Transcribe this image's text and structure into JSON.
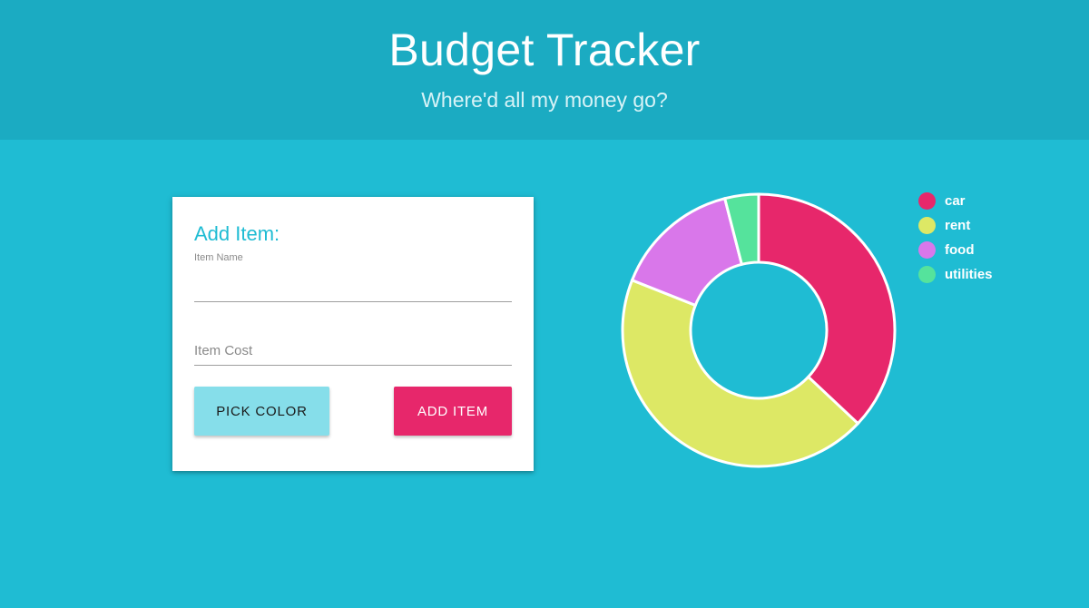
{
  "header": {
    "title": "Budget Tracker",
    "subtitle": "Where'd all my money go?"
  },
  "form": {
    "title": "Add Item:",
    "item_name_label": "Item Name",
    "item_name_value": "",
    "item_cost_placeholder": "Item Cost",
    "item_cost_value": "",
    "pick_color_label": "PICK COLOR",
    "add_item_label": "ADD ITEM"
  },
  "colors": {
    "page_bg": "#1fbcd3",
    "header_bg": "#1babc2",
    "accent": "#1fbcd3",
    "pick_button": "#86deea",
    "add_button": "#e7276b"
  },
  "chart_data": {
    "type": "pie",
    "variant": "doughnut",
    "legend_position": "right",
    "labels": [
      "car",
      "rent",
      "food",
      "utilities"
    ],
    "values": [
      37,
      44,
      15,
      4
    ],
    "colors": [
      "#e7276b",
      "#dde865",
      "#d977ea",
      "#55e39c"
    ]
  }
}
